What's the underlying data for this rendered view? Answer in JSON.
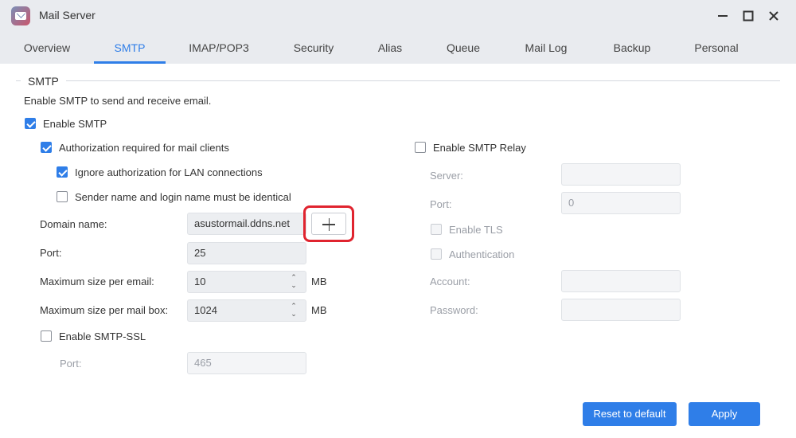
{
  "window": {
    "title": "Mail Server",
    "minimize_icon": "minimize-icon",
    "maximize_icon": "maximize-icon",
    "close_icon": "close-icon"
  },
  "tabs": [
    {
      "label": "Overview"
    },
    {
      "label": "SMTP",
      "active": true
    },
    {
      "label": "IMAP/POP3"
    },
    {
      "label": "Security"
    },
    {
      "label": "Alias"
    },
    {
      "label": "Queue"
    },
    {
      "label": "Mail Log"
    },
    {
      "label": "Backup"
    },
    {
      "label": "Personal"
    }
  ],
  "smtp": {
    "section_title": "SMTP",
    "description": "Enable SMTP to send and receive email.",
    "enable_smtp": {
      "label": "Enable SMTP",
      "checked": true
    },
    "auth_required": {
      "label": "Authorization required for mail clients",
      "checked": true
    },
    "ignore_lan": {
      "label": "Ignore authorization for LAN connections",
      "checked": true
    },
    "sender_identical": {
      "label": "Sender name and login name must be identical",
      "checked": false
    },
    "domain": {
      "label": "Domain name:",
      "value": "asustormail.ddns.net"
    },
    "port": {
      "label": "Port:",
      "value": "25"
    },
    "max_email": {
      "label": "Maximum size per email:",
      "value": "10",
      "unit": "MB"
    },
    "max_mailbox": {
      "label": "Maximum size per mail box:",
      "value": "1024",
      "unit": "MB"
    },
    "ssl": {
      "label": "Enable SMTP-SSL",
      "checked": false,
      "port_label": "Port:",
      "port_value": "465"
    }
  },
  "relay": {
    "enable": {
      "label": "Enable SMTP Relay",
      "checked": false
    },
    "server_label": "Server:",
    "server_value": "",
    "port_label": "Port:",
    "port_value": "0",
    "tls": {
      "label": "Enable TLS",
      "checked": false
    },
    "auth": {
      "label": "Authentication",
      "checked": false
    },
    "account_label": "Account:",
    "account_value": "",
    "password_label": "Password:",
    "password_value": ""
  },
  "buttons": {
    "reset": "Reset to default",
    "apply": "Apply"
  },
  "colors": {
    "accent": "#2f7ee8",
    "highlight": "#e0242f"
  }
}
